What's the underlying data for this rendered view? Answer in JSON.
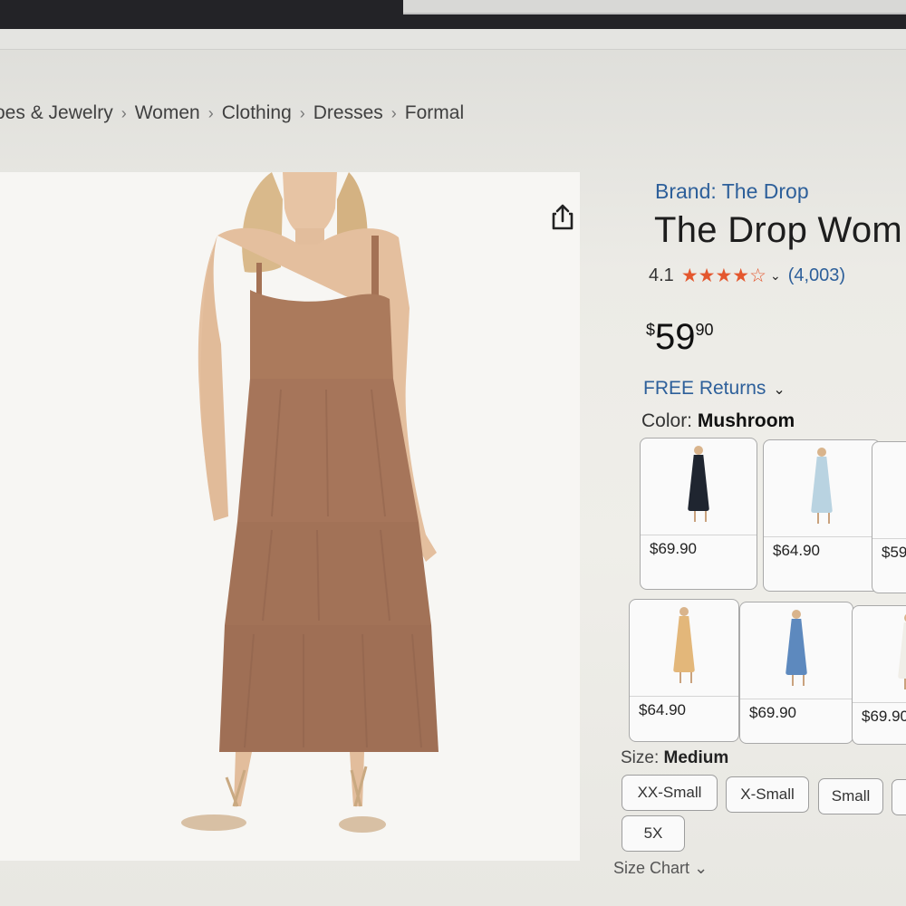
{
  "breadcrumb": [
    "oes & Jewelry",
    "Women",
    "Clothing",
    "Dresses",
    "Formal"
  ],
  "breadcrumb_separator": "›",
  "product": {
    "brand": "Brand: The Drop",
    "title": "The Drop Wom",
    "rating_value": "4.1",
    "stars_display": "★★★★☆",
    "rating_stars": 4.1,
    "rating_caret": "⌄",
    "review_count": "(4,003)",
    "price_symbol": "$",
    "price_whole": "59",
    "price_fraction": "90",
    "free_returns": "FREE Returns",
    "free_returns_caret": "⌄",
    "color_label": "Color:",
    "color_value": "Mushroom",
    "dress_color": "#a8775a"
  },
  "swatches": [
    {
      "price": "$69.90",
      "dress_color": "#1f2530"
    },
    {
      "price": "$64.90",
      "dress_color": "#b9d3e1"
    },
    {
      "price": "$59",
      "dress_color": "#a8775a"
    },
    {
      "price": "$64.90",
      "dress_color": "#e3b77a"
    },
    {
      "price": "$69.90",
      "dress_color": "#5d89be"
    },
    {
      "price": "$69.90",
      "dress_color": "#f0eee8"
    }
  ],
  "size": {
    "label": "Size:",
    "value": "Medium",
    "options": [
      "XX-Small",
      "X-Small",
      "Small",
      "5X"
    ]
  },
  "size_chart": "Size Chart",
  "size_chart_caret": "⌄",
  "colors": {
    "link_blue": "#2d5f9a",
    "star_orange": "#e4572e"
  },
  "icons": [
    "share-icon",
    "chevron-down-icon",
    "star-icon"
  ]
}
